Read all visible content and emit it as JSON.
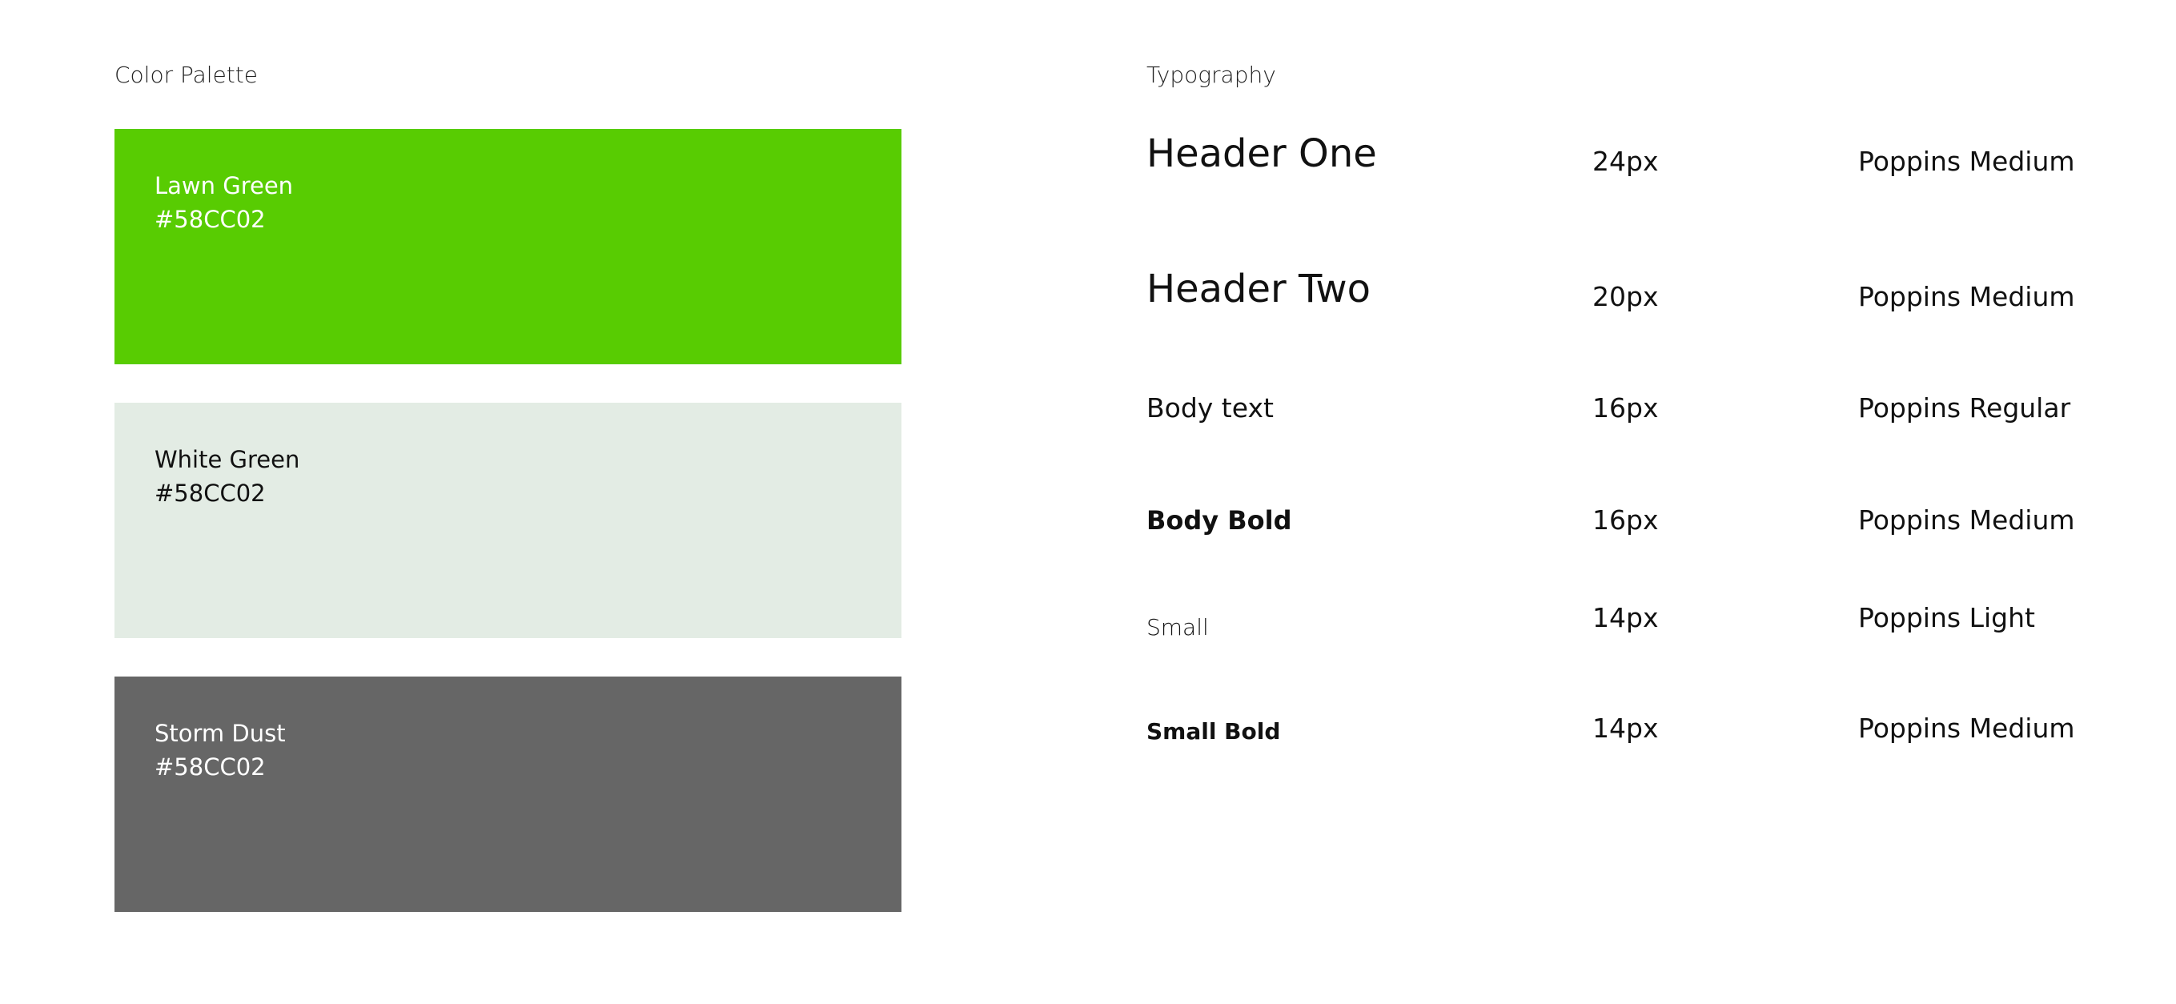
{
  "palette": {
    "title": "Color Palette",
    "swatches": [
      {
        "name": "Lawn Green",
        "hex_label": "#58CC02",
        "background": "#58CC02",
        "text_color": "#ffffff"
      },
      {
        "name": "White Green",
        "hex_label": "#58CC02",
        "background": "#E3ECE4",
        "text_color": "#111111"
      },
      {
        "name": "Storm Dust",
        "hex_label": "#58CC02",
        "background": "#666666",
        "text_color": "#ffffff"
      }
    ]
  },
  "typography": {
    "title": "Typography",
    "rows": [
      {
        "sample": "Header One",
        "size": "24px",
        "font": "Poppins Medium"
      },
      {
        "sample": "Header Two",
        "size": "20px",
        "font": "Poppins Medium"
      },
      {
        "sample": "Body text",
        "size": "16px",
        "font": "Poppins Regular"
      },
      {
        "sample": "Body Bold",
        "size": "16px",
        "font": "Poppins Medium"
      },
      {
        "sample": "Small",
        "size": "14px",
        "font": "Poppins Light"
      },
      {
        "sample": "Small Bold",
        "size": "14px",
        "font": "Poppins Medium"
      }
    ]
  }
}
